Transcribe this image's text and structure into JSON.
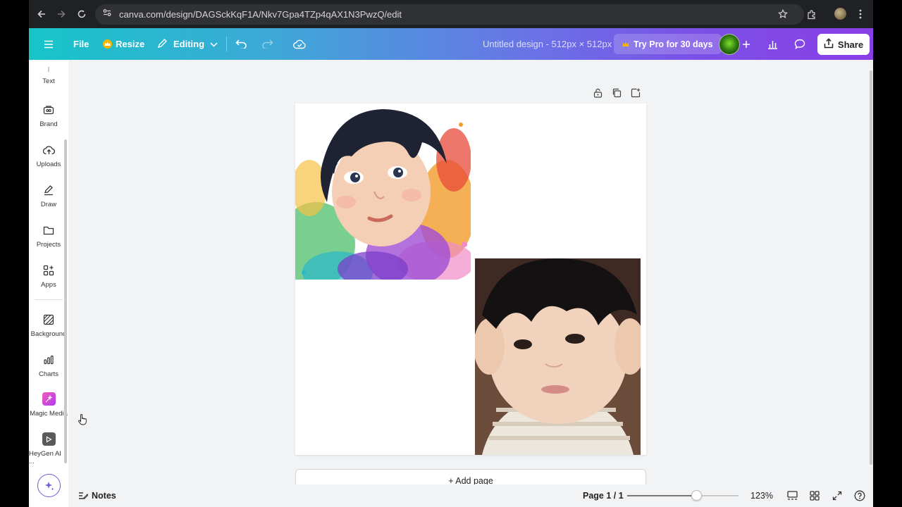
{
  "browser": {
    "url": "canva.com/design/DAGSckKqF1A/Nkv7Gpa4TZp4qAX1N3PwzQ/edit"
  },
  "topbar": {
    "file_label": "File",
    "resize_label": "Resize",
    "editing_label": "Editing",
    "design_title": "Untitled design - 512px × 512px",
    "pro_label": "Try Pro for 30 days",
    "share_label": "Share"
  },
  "sidebar": {
    "items": [
      {
        "label": "Text",
        "icon": "text-icon"
      },
      {
        "label": "Brand",
        "icon": "brand-icon"
      },
      {
        "label": "Uploads",
        "icon": "upload-icon"
      },
      {
        "label": "Draw",
        "icon": "draw-icon"
      },
      {
        "label": "Projects",
        "icon": "folder-icon"
      },
      {
        "label": "Apps",
        "icon": "apps-icon"
      },
      {
        "label": "Background",
        "icon": "background-icon"
      },
      {
        "label": "Charts",
        "icon": "charts-icon"
      },
      {
        "label": "Magic Media",
        "icon": "magic-media-icon"
      },
      {
        "label": "HeyGen AI ...",
        "icon": "heygen-icon"
      }
    ]
  },
  "canvas": {
    "add_page_label": "+ Add page"
  },
  "bottombar": {
    "notes_label": "Notes",
    "page_indicator": "Page 1 / 1",
    "zoom": "123%",
    "zoom_fraction": 0.62
  },
  "colors": {
    "accent_purple": "#8a3ee8",
    "accent_teal": "#16c5c8"
  }
}
